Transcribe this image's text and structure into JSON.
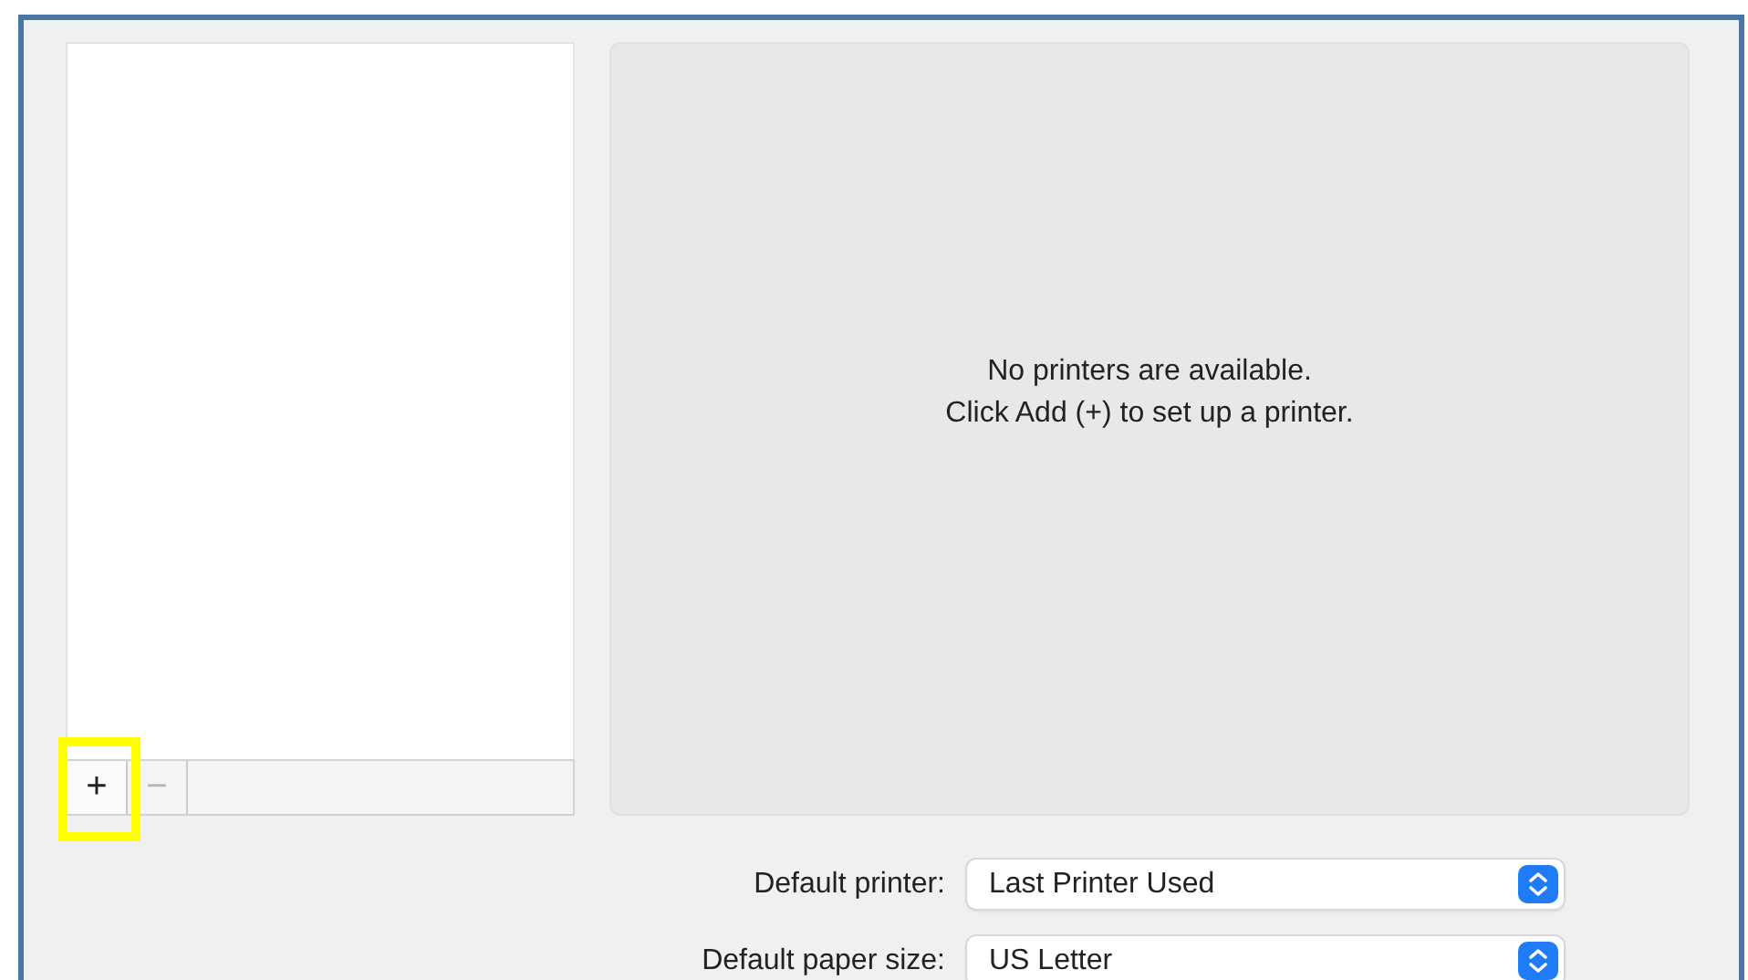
{
  "printer_list": {
    "buttons": [
      {
        "label": "+",
        "disabled": false,
        "highlighted": true
      },
      {
        "label": "−",
        "disabled": true,
        "highlighted": false
      }
    ]
  },
  "detail_panel": {
    "message": [
      "No printers are available.",
      "Click Add (+) to set up a printer."
    ]
  },
  "settings": [
    {
      "label": "Default printer:",
      "value": "Last Printer Used"
    },
    {
      "label": "Default paper size:",
      "value": "US Letter"
    }
  ]
}
